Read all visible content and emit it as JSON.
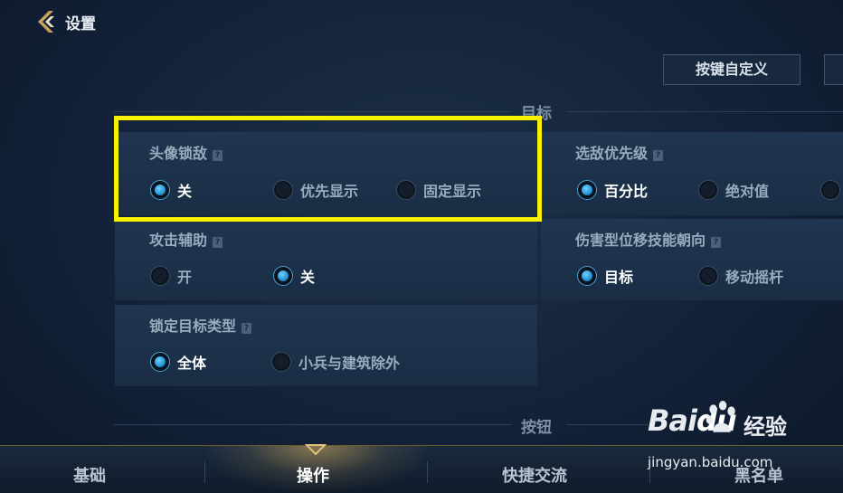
{
  "header": {
    "title": "设置"
  },
  "toolbar": {
    "custom_keys_label": "按键自定义"
  },
  "sections": {
    "target_title": "目标",
    "button_title": "按钮"
  },
  "settings": {
    "avatar_lock": {
      "label": "头像锁敌",
      "options": [
        "关",
        "优先显示",
        "固定显示"
      ],
      "selected": "关"
    },
    "enemy_priority": {
      "label": "选敌优先级",
      "options": [
        "百分比",
        "绝对值"
      ],
      "selected": "百分比"
    },
    "attack_assist": {
      "label": "攻击辅助",
      "options": [
        "开",
        "关"
      ],
      "selected": "关"
    },
    "damage_skill_direction": {
      "label": "伤害型位移技能朝向",
      "options": [
        "目标",
        "移动摇杆"
      ],
      "selected": "目标"
    },
    "lock_target_type": {
      "label": "锁定目标类型",
      "options": [
        "全体",
        "小兵与建筑除外"
      ],
      "selected": "全体"
    }
  },
  "bottom_nav": {
    "tabs": [
      "基础",
      "操作",
      "快捷交流",
      "黑名单"
    ],
    "active": "操作"
  },
  "watermark": {
    "logo_a": "Bai",
    "logo_b": "du",
    "text": "经验",
    "url": "jingyan.baidu.com"
  },
  "colors": {
    "highlight": "#f7f300",
    "accent": "#2b9ad9",
    "active_tab_glow": "#e2b860"
  }
}
